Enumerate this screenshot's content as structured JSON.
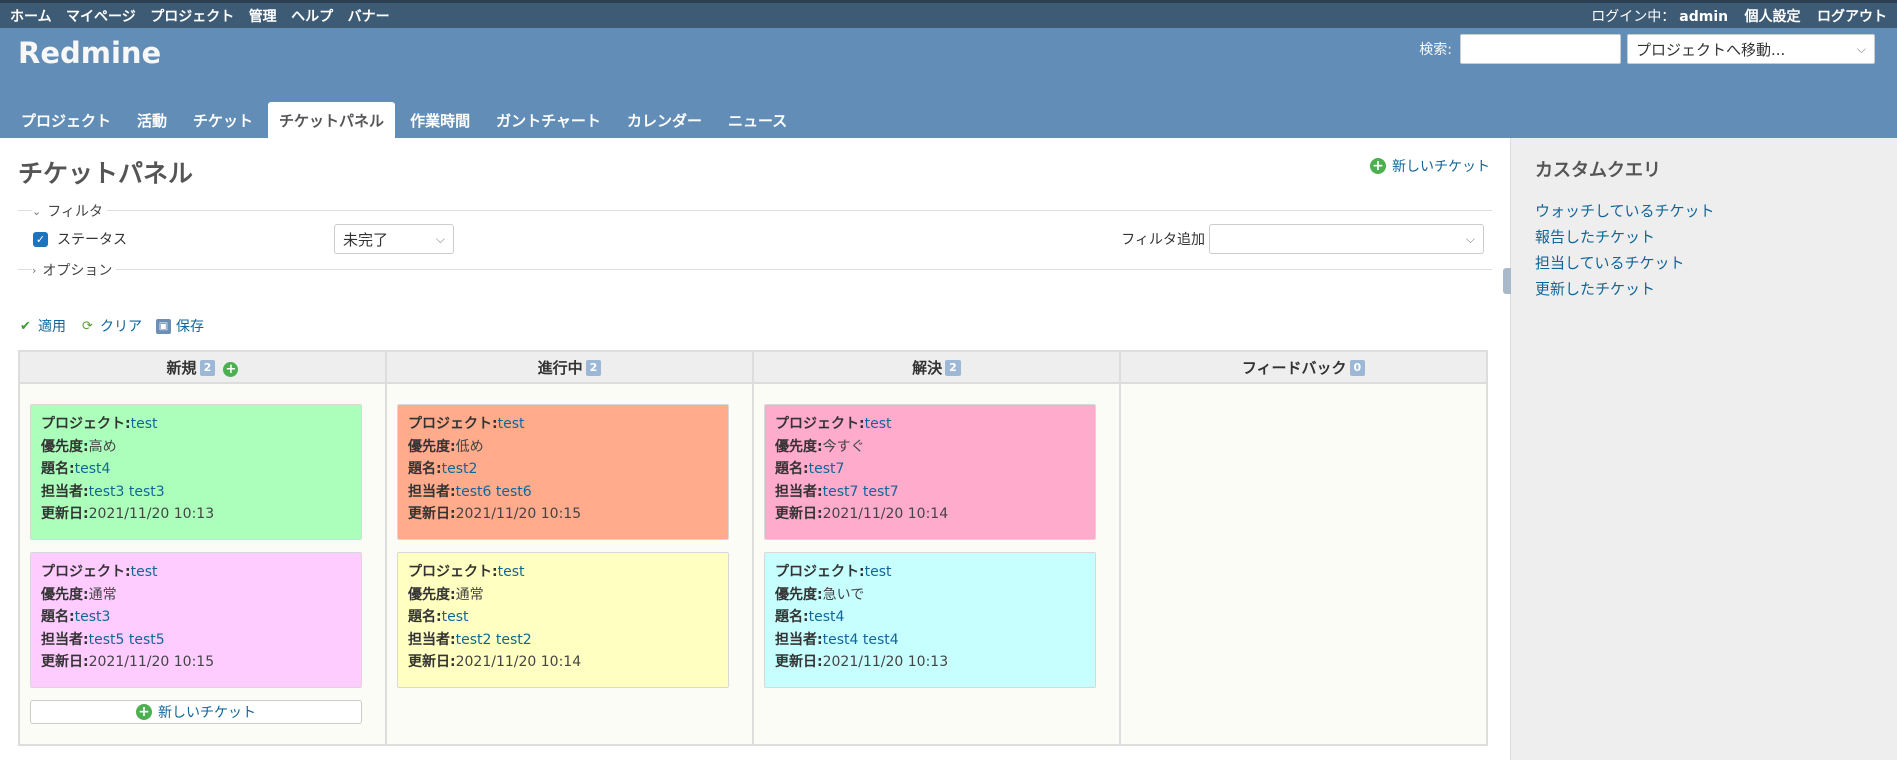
{
  "top_menu": {
    "left": [
      "ホーム",
      "マイページ",
      "プロジェクト",
      "管理",
      "ヘルプ",
      "バナー"
    ],
    "login_label": "ログイン中：",
    "login_user": "admin",
    "my_account": "個人設定",
    "logout": "ログアウト"
  },
  "header": {
    "title": "Redmine",
    "search_label": "検索:",
    "search_value": "",
    "jump_placeholder": "プロジェクトへ移動..."
  },
  "main_menu": [
    "プロジェクト",
    "活動",
    "チケット",
    "チケットパネル",
    "作業時間",
    "ガントチャート",
    "カレンダー",
    "ニュース"
  ],
  "page": {
    "title": "チケットパネル",
    "new_issue": "新しいチケット",
    "filter_legend": "フィルタ",
    "status_label": "ステータス",
    "status_value": "未完了",
    "add_filter_label": "フィルタ追加",
    "options_legend": "オプション",
    "apply": "適用",
    "clear": "クリア",
    "save": "保存"
  },
  "board": {
    "field_labels": {
      "project": "プロジェクト:",
      "priority": "優先度:",
      "subject": "題名:",
      "assignee": "担当者:",
      "updated": "更新日:"
    },
    "columns": [
      {
        "name": "新規",
        "count": "2",
        "cards": [
          {
            "color": "#abffbb",
            "project": "test",
            "priority": "高め",
            "subject": "test4",
            "assignee": "test3 test3",
            "updated": "2021/11/20 10:13"
          },
          {
            "color": "#ffccff",
            "project": "test",
            "priority": "通常",
            "subject": "test3",
            "assignee": "test5 test5",
            "updated": "2021/11/20 10:15"
          }
        ]
      },
      {
        "name": "進行中",
        "count": "2",
        "cards": [
          {
            "color": "#ffab8c",
            "project": "test",
            "priority": "低め",
            "subject": "test2",
            "assignee": "test6 test6",
            "updated": "2021/11/20 10:15"
          },
          {
            "color": "#ffffc2",
            "project": "test",
            "priority": "通常",
            "subject": "test",
            "assignee": "test2 test2",
            "updated": "2021/11/20 10:14"
          }
        ]
      },
      {
        "name": "解決",
        "count": "2",
        "cards": [
          {
            "color": "#ffabcc",
            "project": "test",
            "priority": "今すぐ",
            "subject": "test7",
            "assignee": "test7 test7",
            "updated": "2021/11/20 10:14"
          },
          {
            "color": "#c7ffff",
            "project": "test",
            "priority": "急いで",
            "subject": "test4",
            "assignee": "test4 test4",
            "updated": "2021/11/20 10:13"
          }
        ]
      },
      {
        "name": "フィードバック",
        "count": "0",
        "cards": []
      }
    ],
    "new_ticket_button": "新しいチケット"
  },
  "sidebar": {
    "title": "カスタムクエリ",
    "items": [
      "ウォッチしているチケット",
      "報告したチケット",
      "担当しているチケット",
      "更新したチケット"
    ]
  }
}
